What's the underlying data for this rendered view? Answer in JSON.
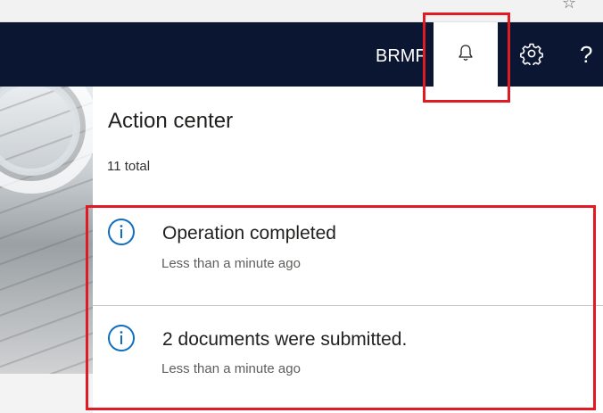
{
  "header": {
    "company": "BRMF",
    "bell_icon": "bell-icon",
    "settings_icon": "gear-icon",
    "help_label": "?",
    "nav_bg_color": "#0b1633"
  },
  "action_center": {
    "title": "Action center",
    "total": "11 total",
    "notifications": [
      {
        "icon": "info-icon",
        "title": "Operation completed",
        "time": "Less than a minute ago"
      },
      {
        "icon": "info-icon",
        "title": "2 documents were submitted.",
        "time": "Less than a minute ago"
      }
    ]
  },
  "colors": {
    "info_icon": "#106ebe",
    "highlight": "#e01b24"
  }
}
